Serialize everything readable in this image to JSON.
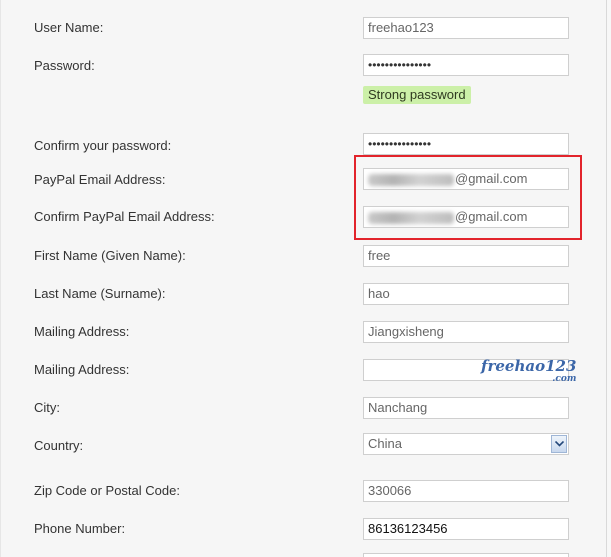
{
  "form": {
    "username": {
      "label": "User Name:",
      "value": "freehao123"
    },
    "password": {
      "label": "Password:",
      "value": "•••••••••••••••"
    },
    "password_strength": "Strong password",
    "confirm_password": {
      "label": "Confirm your password:",
      "value": "•••••••••••••••"
    },
    "paypal_email": {
      "label": "PayPal Email Address:",
      "suffix": "@gmail.com"
    },
    "confirm_paypal_email": {
      "label": "Confirm PayPal Email Address:",
      "suffix": "@gmail.com"
    },
    "first_name": {
      "label": "First Name (Given Name):",
      "value": "free"
    },
    "last_name": {
      "label": "Last Name (Surname):",
      "value": "hao"
    },
    "mailing_address_1": {
      "label": "Mailing Address:",
      "value": "Jiangxisheng"
    },
    "mailing_address_2": {
      "label": "Mailing Address:",
      "value": ""
    },
    "city": {
      "label": "City:",
      "value": "Nanchang"
    },
    "country": {
      "label": "Country:",
      "value": "China"
    },
    "zip": {
      "label": "Zip Code or Postal Code:",
      "value": "330066"
    },
    "phone": {
      "label": "Phone Number:",
      "value": "86136123456"
    }
  },
  "watermark": {
    "main": "freehao123",
    "sub": ".com"
  },
  "colors": {
    "highlight_border": "#e2242b",
    "strength_badge": "#ccf0a8"
  }
}
